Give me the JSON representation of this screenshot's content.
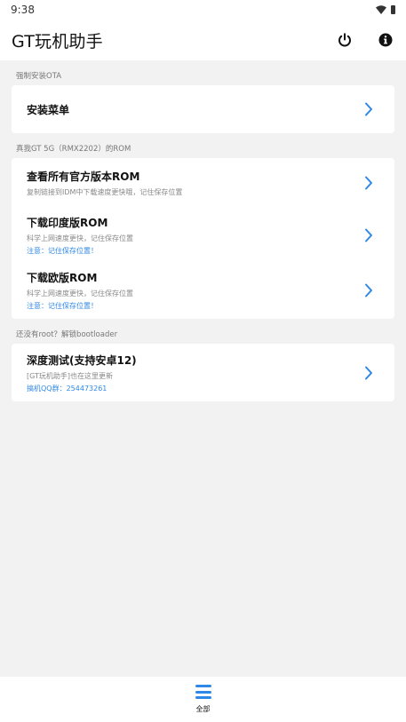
{
  "status_bar": {
    "time": "9:38",
    "icons": [
      "wifi-icon",
      "battery-icon"
    ]
  },
  "app_bar": {
    "title": "GT玩机助手",
    "actions": [
      "power-icon",
      "info-icon"
    ]
  },
  "colors": {
    "accent": "#2f88e6",
    "background": "#f2f2f2",
    "card": "#ffffff"
  },
  "sections": [
    {
      "label": "强制安装OTA",
      "items": [
        {
          "title": "安装菜单"
        }
      ]
    },
    {
      "label": "真我GT 5G（RMX2202）的ROM",
      "items": [
        {
          "title": "查看所有官方版本ROM",
          "subtitle": "复制链接到IDM中下载速度更快哦，记住保存位置"
        },
        {
          "title": "下载印度版ROM",
          "subtitle": "科学上网速度更快，记住保存位置",
          "note": "注意：记住保存位置！"
        },
        {
          "title": "下载欧版ROM",
          "subtitle": "科学上网速度更快，记住保存位置",
          "note": "注意：记住保存位置！"
        }
      ]
    },
    {
      "label": "还没有root？解锁bootloader",
      "items": [
        {
          "title": "深度测试(支持安卓12)",
          "subtitle": "[GT玩机助手]也在这里更新",
          "note": "搞机QQ群：254473261"
        }
      ]
    }
  ],
  "bottom_nav": {
    "items": [
      {
        "label": "全部",
        "icon": "menu-icon"
      }
    ]
  }
}
